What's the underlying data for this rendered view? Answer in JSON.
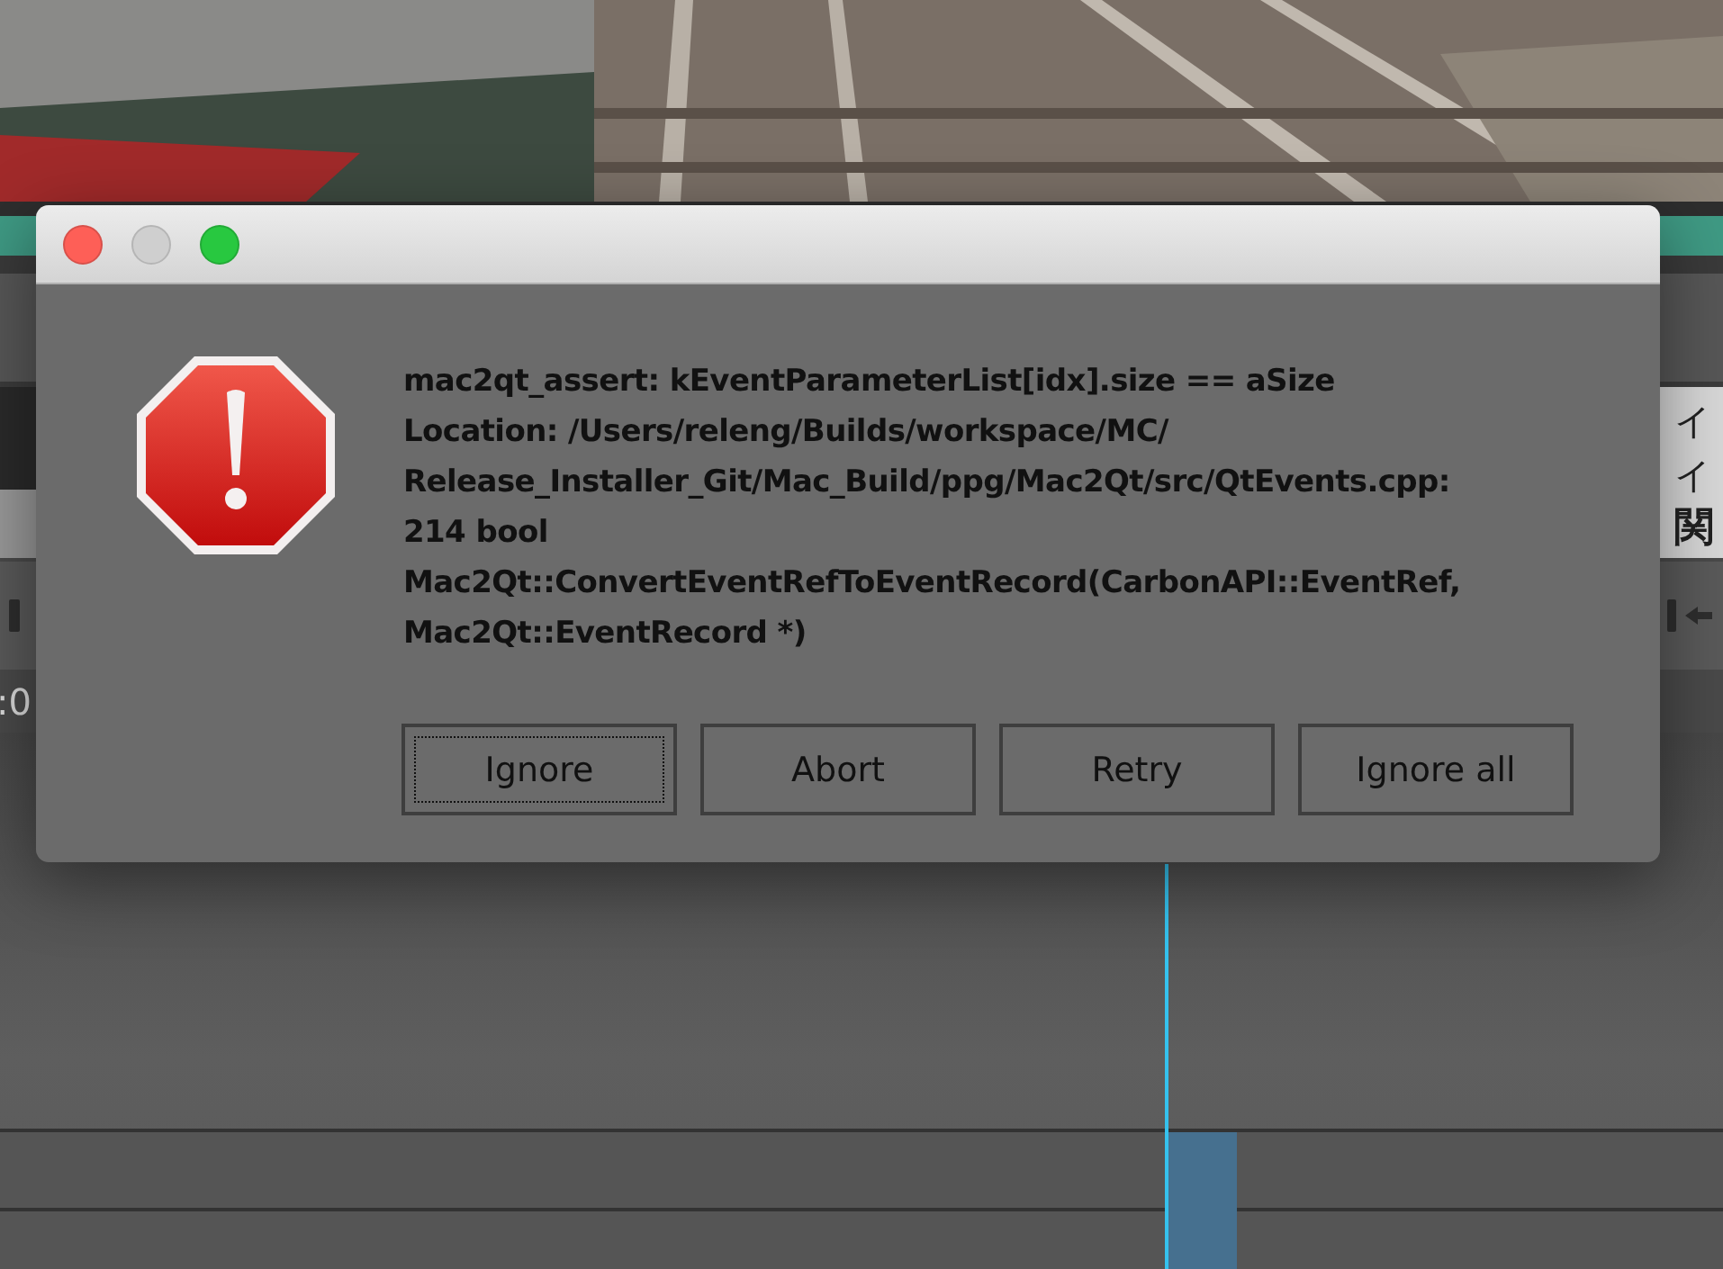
{
  "background": {
    "video": {
      "kind": "picture"
    },
    "side_texts": [
      "イ",
      "イ",
      "関"
    ],
    "timecode": ":0"
  },
  "dialog": {
    "controls": [
      {
        "kind": "close",
        "enabled": true
      },
      {
        "kind": "minimize",
        "enabled": false
      },
      {
        "kind": "zoom",
        "enabled": true
      }
    ],
    "message": "mac2qt_assert: kEventParameterList[idx].size == aSize\nLocation: /Users/releng/Builds/workspace/MC/\nRelease_Installer_Git/Mac_Build/ppg/Mac2Qt/src/QtEvents.cpp:\n214 bool\nMac2Qt::ConvertEventRefToEventRecord(CarbonAPI::EventRef,\nMac2Qt::EventRecord *)",
    "buttons": [
      {
        "label": "Ignore",
        "focused": true
      },
      {
        "label": "Abort",
        "focused": false
      },
      {
        "label": "Retry",
        "focused": false
      },
      {
        "label": "Ignore all",
        "focused": false
      }
    ]
  }
}
